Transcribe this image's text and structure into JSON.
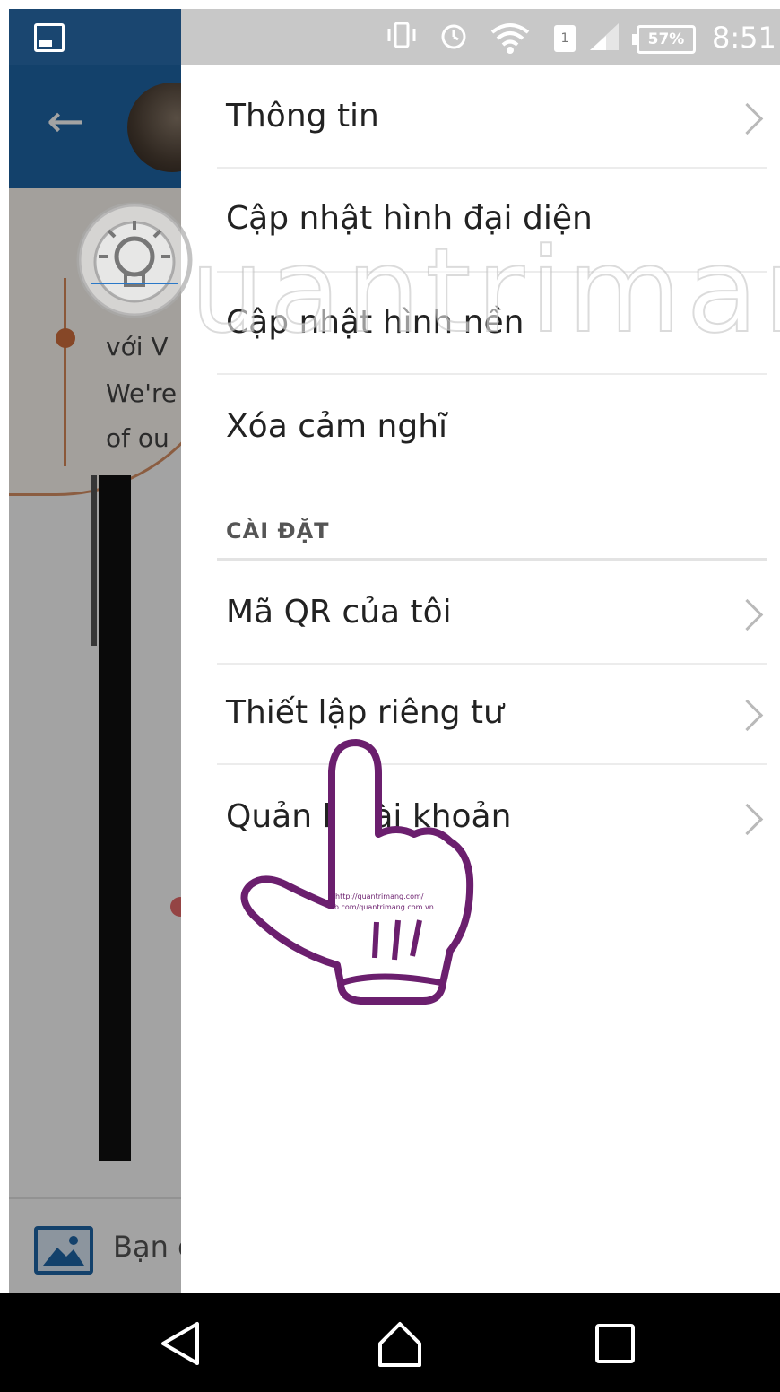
{
  "status_bar": {
    "battery": "57%",
    "time": "8:51"
  },
  "background_app": {
    "text_lines": [
      "với V",
      "We're",
      "of ou"
    ],
    "compose_placeholder": "Bạn c"
  },
  "drawer": {
    "items": [
      {
        "label": "Thông tin",
        "chevron": true
      },
      {
        "label": "Cập nhật hình đại diện",
        "chevron": false
      },
      {
        "label": "Cập nhật hình nền",
        "chevron": false
      },
      {
        "label": "Xóa cảm nghĩ",
        "chevron": false
      }
    ],
    "section_title": "CÀI ĐẶT",
    "settings_items": [
      {
        "label": "Mã QR của tôi",
        "chevron": true
      },
      {
        "label": "Thiết lập riêng tư",
        "chevron": true
      },
      {
        "label": "Quản lý tài khoản",
        "chevron": true
      }
    ]
  },
  "watermark": {
    "text": "uantrimang",
    "hand_caption_1": "http://quantrimang.com/",
    "hand_caption_2": "fb.com/quantrimang.com.vn"
  },
  "nav_bar": {
    "icons": [
      "back-triangle-icon",
      "home-icon",
      "recents-square-icon"
    ]
  }
}
